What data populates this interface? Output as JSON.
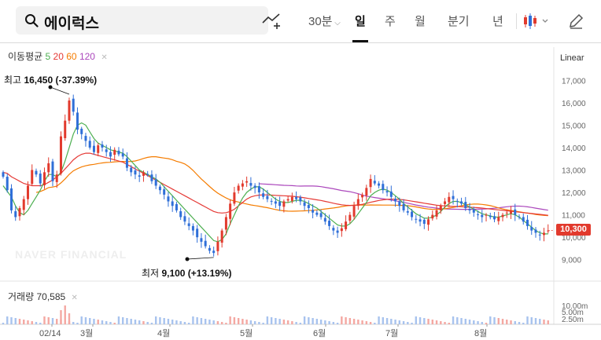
{
  "search": {
    "value": "에이럭스"
  },
  "periods": [
    "30분",
    "일",
    "주",
    "월",
    "분기",
    "년"
  ],
  "active_period": "일",
  "ma_legend": {
    "label": "이동평균",
    "items": [
      {
        "name": "5",
        "color": "#4caf50"
      },
      {
        "name": "20",
        "color": "#e53935"
      },
      {
        "name": "60",
        "color": "#f57c00"
      },
      {
        "name": "120",
        "color": "#ab47bc"
      }
    ]
  },
  "scale_mode": "Linear",
  "watermark": "NAVER FINANCIAL",
  "annotations": {
    "high_label": "최고",
    "high_value": "16,450 (-37.39%)",
    "low_label": "최저",
    "low_value": "9,100 (+13.19%)"
  },
  "current_price": "10,300",
  "volume": {
    "label": "거래량",
    "value": "70,585",
    "axis_ticks": [
      "10.00m",
      "5.00m",
      "2.50m"
    ]
  },
  "chart_data": {
    "type": "candlestick",
    "y_ticks": [
      17000,
      16000,
      15000,
      14000,
      13000,
      12000,
      11000,
      10000,
      9000
    ],
    "x_labels": [
      "02/14",
      "3월",
      "4월",
      "5월",
      "6월",
      "7월",
      "8월"
    ],
    "ylim": [
      8500,
      17500
    ],
    "high": 16450,
    "low": 9100,
    "last": 10300,
    "close_series": [
      12700,
      12100,
      11200,
      10900,
      11300,
      11700,
      12300,
      13000,
      12800,
      12400,
      12900,
      13300,
      12500,
      12800,
      14500,
      15200,
      16100,
      15600,
      14800,
      14600,
      14300,
      14000,
      13800,
      14100,
      14000,
      13800,
      13600,
      13900,
      13700,
      13600,
      13100,
      12900,
      12800,
      12700,
      12900,
      12800,
      12500,
      12300,
      12100,
      11900,
      11600,
      11400,
      11200,
      10900,
      10700,
      10500,
      10300,
      10000,
      9800,
      9600,
      9400,
      9300,
      9800,
      10300,
      10900,
      11500,
      12000,
      12300,
      12400,
      12500,
      12300,
      12200,
      12000,
      11800,
      11700,
      11600,
      11500,
      11400,
      11600,
      11700,
      11800,
      11700,
      11600,
      11400,
      11300,
      11100,
      11000,
      10900,
      10700,
      10500,
      10300,
      10200,
      10400,
      10700,
      11000,
      11400,
      11700,
      11900,
      12200,
      12600,
      12400,
      12300,
      12100,
      12000,
      11800,
      11600,
      11400,
      11200,
      11100,
      10900,
      10800,
      10700,
      10600,
      10800,
      11000,
      11200,
      11400,
      11600,
      11800,
      11700,
      11600,
      11500,
      11300,
      11200,
      11100,
      11000,
      10900,
      11000,
      10900,
      10800,
      10900,
      11000,
      11100,
      11200,
      11000,
      10900,
      10700,
      10500,
      10300,
      10200,
      10100,
      10200,
      10300
    ],
    "ma5": [
      12300,
      12050,
      11800,
      11400,
      11100,
      11000,
      11200,
      11500,
      11800,
      12100,
      12500,
      12800,
      12800,
      12700,
      12900,
      13400,
      14000,
      14600,
      15000,
      15100,
      15000,
      14700,
      14400,
      14200,
      14100,
      14000,
      13900,
      13850,
      13800,
      13750,
      13600,
      13400,
      13200,
      13000,
      12900,
      12800,
      12700,
      12600,
      12450,
      12250,
      12050,
      11850,
      11650,
      11450,
      11250,
      11050,
      10850,
      10650,
      10450,
      10250,
      10050,
      9850,
      9800,
      9900,
      10150,
      10600,
      11000,
      11400,
      11750,
      12000,
      12150,
      12250,
      12250,
      12150,
      12000,
      11850,
      11700,
      11600,
      11550,
      11550,
      11600,
      11650,
      11650,
      11600,
      11500,
      11400,
      11300,
      11150,
      11000,
      10850,
      10700,
      10550,
      10500,
      10500,
      10600,
      10800,
      11050,
      11300,
      11550,
      11850,
      12000,
      12100,
      12150,
      12100,
      12000,
      11850,
      11700,
      11500,
      11350,
      11200,
      11050,
      10950,
      10850,
      10850,
      10900,
      11000,
      11150,
      11350,
      11500,
      11600,
      11600,
      11550,
      11450,
      11350,
      11250,
      11150,
      11050,
      11000,
      10950,
      10900,
      10900,
      10950,
      11000,
      11050,
      11000,
      10900,
      10750,
      10600,
      10450,
      10300,
      10200,
      10150,
      10150
    ],
    "ma20": [
      12900,
      12850,
      12700,
      12600,
      12500,
      12400,
      12350,
      12300,
      12300,
      12300,
      12350,
      12450,
      12550,
      12700,
      12850,
      13050,
      13250,
      13450,
      13600,
      13700,
      13750,
      13750,
      13700,
      13650,
      13600,
      13550,
      13500,
      13450,
      13400,
      13350,
      13250,
      13150,
      13050,
      12950,
      12850,
      12750,
      12650,
      12550,
      12450,
      12350,
      12250,
      12150,
      12050,
      11950,
      11850,
      11750,
      11650,
      11550,
      11450,
      11350,
      11250,
      11150,
      11100,
      11080,
      11100,
      11150,
      11250,
      11400,
      11550,
      11700,
      11800,
      11850,
      11880,
      11890,
      11890,
      11880,
      11870,
      11860,
      11850,
      11840,
      11830,
      11810,
      11790,
      11760,
      11730,
      11700,
      11670,
      11640,
      11600,
      11560,
      11520,
      11480,
      11450,
      11430,
      11420,
      11420,
      11440,
      11470,
      11510,
      11560,
      11600,
      11640,
      11670,
      11690,
      11700,
      11700,
      11690,
      11670,
      11640,
      11610,
      11580,
      11550,
      11520,
      11490,
      11460,
      11430,
      11410,
      11400,
      11390,
      11380,
      11370,
      11360,
      11350,
      11340,
      11330,
      11320,
      11300,
      11280,
      11260,
      11240,
      11220,
      11200,
      11180,
      11160,
      11140,
      11120,
      11100,
      11080,
      11060,
      11040,
      11020,
      11000,
      10980
    ],
    "ma60": [
      null,
      null,
      null,
      null,
      null,
      null,
      null,
      null,
      null,
      null,
      null,
      null,
      null,
      null,
      null,
      null,
      null,
      null,
      null,
      null,
      null,
      null,
      null,
      null,
      null,
      null,
      null,
      null,
      null,
      null,
      null,
      null,
      null,
      null,
      null,
      null,
      null,
      null,
      null,
      null,
      null,
      null,
      null,
      null,
      null,
      null,
      null,
      null,
      null,
      null,
      null,
      null,
      null,
      null,
      null,
      null,
      null,
      null,
      null,
      null,
      null,
      null,
      null,
      null,
      null,
      null,
      null,
      null,
      null,
      null,
      null,
      null,
      null,
      null,
      null,
      null,
      null,
      null,
      null,
      null,
      null,
      null,
      null,
      null,
      null,
      null,
      null,
      null,
      null,
      null,
      null,
      null,
      null,
      null,
      null,
      null,
      null,
      null,
      null,
      null,
      null,
      null,
      null,
      null,
      null,
      null,
      null,
      null,
      null,
      null,
      null,
      null,
      null,
      null,
      null,
      null,
      null,
      null,
      null,
      null,
      null,
      null,
      null,
      null,
      null,
      null,
      null,
      null,
      null,
      null,
      null,
      null,
      null
    ],
    "ma120": []
  }
}
